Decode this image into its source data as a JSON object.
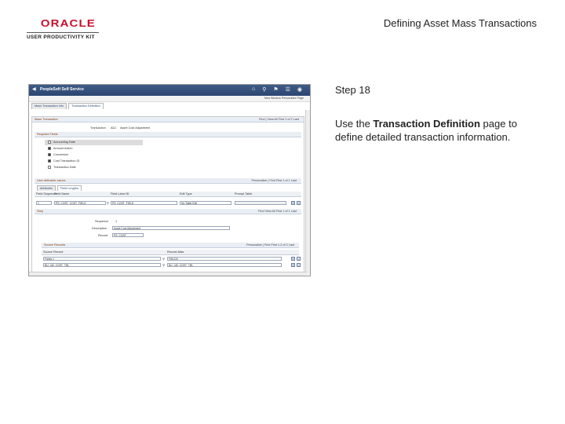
{
  "header": {
    "logo_word": "ORACLE",
    "logo_sub": "USER PRODUCTIVITY KIT",
    "title": "Defining Asset Mass Transactions"
  },
  "step": {
    "title": "Step 18",
    "body_pre": "Use the ",
    "body_bold": "Transaction Definition",
    "body_post": " page to define detailed transaction information."
  },
  "screenshot": {
    "app_name": "PeopleSoft Self Service",
    "subbar": "New Window   Personalize Page",
    "tabs": [
      "Mass Transaction Info",
      "Transaction Definition"
    ],
    "mass_trans": {
      "header": "Mass Transaction",
      "nav": "Find | View All    First  1 of 2  Last",
      "transaction_label": "Transaction",
      "transaction_value": "ADJ",
      "transaction_desc": "Asset Cost Adjustment"
    },
    "required_fields": {
      "header": "Required Fields",
      "items": [
        {
          "label": "Accounting Date",
          "checked": false
        },
        {
          "label": "Amount Action",
          "checked": true
        },
        {
          "label": "Conversion",
          "checked": true
        },
        {
          "label": "Cost Transaction ID",
          "checked": true
        },
        {
          "label": "Transaction Date",
          "checked": false
        }
      ]
    },
    "user_values": {
      "header": "User definable values",
      "nav": "Personalize | Find    First  1 of 1  Last",
      "subtabs": [
        "Attributes",
        "Field Lengths"
      ],
      "columns": [
        "Field Sequence",
        "Field Name",
        "Field Label ID",
        "Edit Type",
        "Prompt Table"
      ],
      "row": {
        "seq": "1",
        "name": "PS_COST_COST_FIELD",
        "label_id": "PS_COST_FIELD",
        "edit": "No Table Edit"
      }
    },
    "step_sec": {
      "header": "Step",
      "nav": "Find  View All    First  1 of 1  Last",
      "sequence_label": "Sequence",
      "sequence_value": "1",
      "description_label": "Description",
      "description_value": "Asset Cost Adjustment",
      "record_label": "Record",
      "record_value": "PS_COST"
    },
    "source_records": {
      "header": "Source Records",
      "nav": "Personalize | Find    First  1-2 of 2  Last",
      "columns": [
        "Source Record",
        "Record Alias"
      ],
      "rows": [
        {
          "record": "Fields 1",
          "alias": "FIELDS"
        },
        {
          "record": "BU_LIB_COST_TBL",
          "alias": "BU_LIB_COST_TBL"
        }
      ]
    }
  }
}
